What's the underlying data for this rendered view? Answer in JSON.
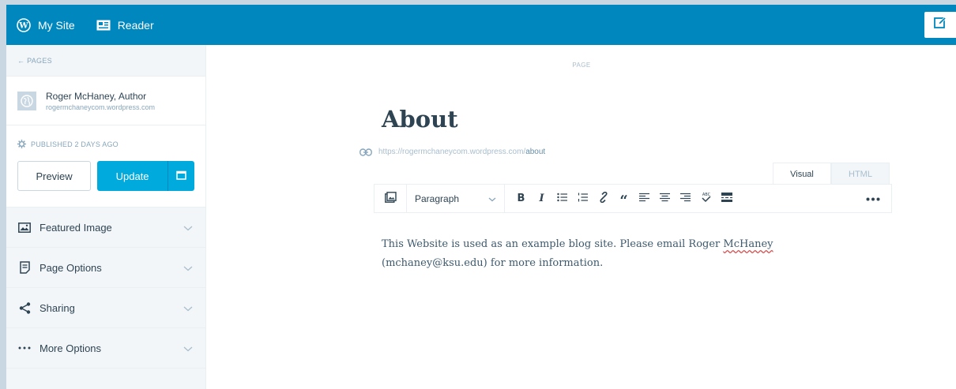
{
  "topbar": {
    "my_site_label": "My Site",
    "reader_label": "Reader",
    "accent": "#0087be"
  },
  "sidebar": {
    "back_label": "← PAGES",
    "site_name": "Roger McHaney, Author",
    "site_url": "rogermchaneycom.wordpress.com",
    "status_label": "PUBLISHED 2 DAYS AGO",
    "preview_label": "Preview",
    "update_label": "Update",
    "sections": [
      {
        "label": "Featured Image",
        "icon": "image-icon"
      },
      {
        "label": "Page Options",
        "icon": "document-icon"
      },
      {
        "label": "Sharing",
        "icon": "share-icon"
      },
      {
        "label": "More Options",
        "icon": "ellipsis-icon"
      }
    ]
  },
  "editor": {
    "page_label": "PAGE",
    "title": "About",
    "permalink_base": "https://rogermchaneycom.wordpress.com/",
    "permalink_slug": "about",
    "tabs": {
      "visual": "Visual",
      "html": "HTML",
      "active": "Visual"
    },
    "paragraph_format": "Paragraph",
    "content_before": "This Website is used as an example blog site. Please email Roger ",
    "content_spell": "McHaney",
    "content_after": "(mchaney@ksu.edu) for more information."
  },
  "colors": {
    "update_button": "#00aadc",
    "sidebar_bg": "#f3f6f8"
  }
}
